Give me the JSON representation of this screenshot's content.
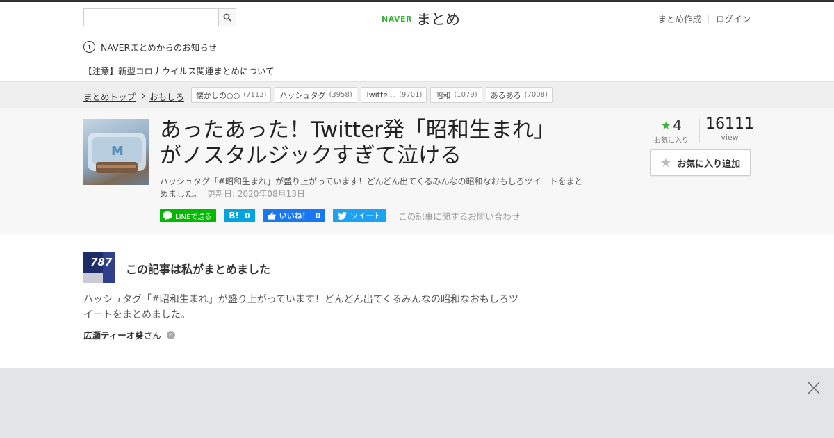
{
  "header": {
    "search": {
      "value": "",
      "placeholder": ""
    },
    "logo": {
      "naver": "NAVER",
      "matome": "まとめ"
    },
    "links": [
      {
        "label": "まとめ作成"
      },
      {
        "label": "ログイン"
      }
    ]
  },
  "notice": {
    "heading": "NAVERまとめからのお知らせ",
    "item": "【注意】新型コロナウイルス関連まとめについて"
  },
  "breadcrumb": {
    "items": [
      {
        "label": "まとめトップ"
      },
      {
        "label": "おもしろ"
      }
    ],
    "tags": [
      {
        "label": "懐かしの○○",
        "count": "(7112)"
      },
      {
        "label": "ハッシュタグ",
        "count": "(3958)"
      },
      {
        "label": "Twitte…",
        "count": "(9701)"
      },
      {
        "label": "昭和",
        "count": "(1079)"
      },
      {
        "label": "あるある",
        "count": "(7008)"
      }
    ]
  },
  "article": {
    "title_line1": "あったあった！Twitter発「昭和生まれ」",
    "title_line2": "がノスタルジックすぎて泣ける",
    "description": "ハッシュタグ「#昭和生まれ」が盛り上がっています！どんどん出てくるみんなの昭和なおもしろツイートをまとめました。",
    "updated": "更新日: 2020年08月13日",
    "share": {
      "line": "LINEで送る",
      "hatena_icon": "B!",
      "hatena_count": "0",
      "fb_label": "いいね！",
      "fb_count": "0",
      "tweet": "ツイート"
    },
    "contact": "この記事に関するお問い合わせ",
    "stats": {
      "fav_count": "4",
      "fav_label": "お気に入り",
      "views": "16111",
      "views_label": "view"
    },
    "fav_button": "お気に入り追加"
  },
  "author": {
    "heading": "この記事は私がまとめました",
    "description": "ハッシュタグ「#昭和生まれ」が盛り上がっています！どんどん出てくるみんなの昭和なおもしろツイートをまとめました。",
    "name": "広瀬ティーオ葵",
    "suffix": "さん",
    "avatar_text": "787"
  },
  "colors": {
    "accent": "#3db039",
    "line": "#00b900",
    "hatena": "#00a4de",
    "facebook": "#1877f2",
    "twitter": "#1da1f2"
  }
}
